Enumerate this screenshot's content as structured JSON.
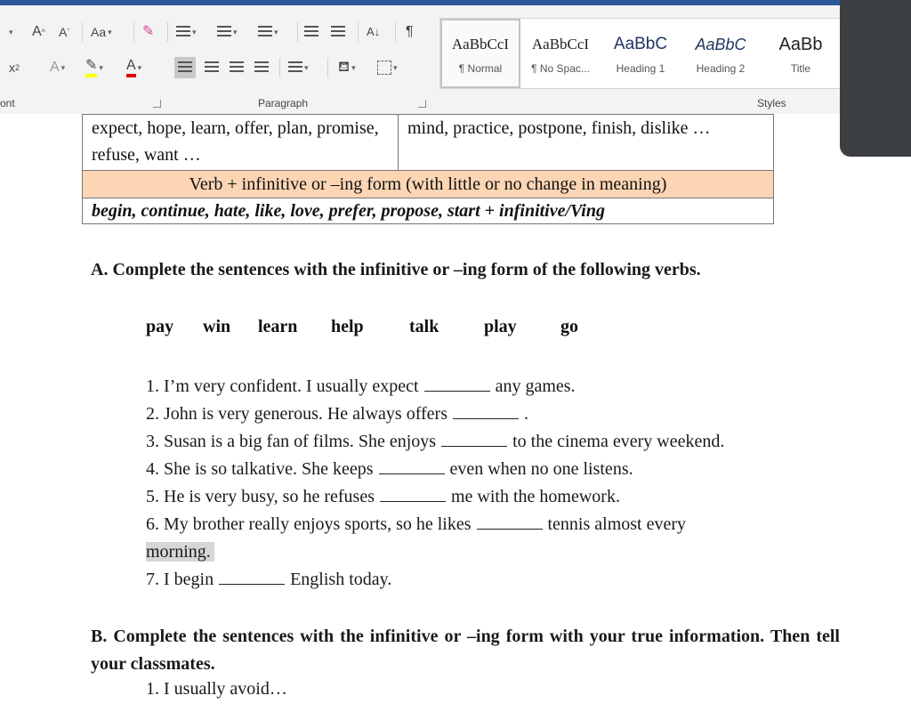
{
  "ribbon": {
    "font_group_label": "ont",
    "paragraph_group_label": "Paragraph",
    "styles_group_label": "Styles",
    "font_size_grow": "A",
    "font_size_shrink": "A",
    "change_case": "Aa",
    "subscript": "x",
    "text_effects": "A",
    "font_color": "A",
    "sort": "A↓",
    "pilcrow": "¶",
    "highlight_color": "#ffff00",
    "font_color_value": "#e00000",
    "styles": [
      {
        "sample": "AaBbCcI",
        "name": "¶ Normal"
      },
      {
        "sample": "AaBbCcI",
        "name": "¶ No Spac..."
      },
      {
        "sample": "AaBbC",
        "name": "Heading 1"
      },
      {
        "sample": "AaBbC",
        "name": "Heading 2"
      },
      {
        "sample": "AaBb",
        "name": "Title"
      }
    ]
  },
  "table": {
    "left_cell": "expect, hope, learn, offer, plan, promise, refuse, want …",
    "right_cell": "mind, practice, postpone, finish, dislike …",
    "band_header": "Verb + infinitive or –ing form (with little or no change in meaning)",
    "band_row": "begin, continue, hate, like, love, prefer, propose, start + infinitive/Ving",
    "band_color": "#fcd5b4"
  },
  "sectionA": {
    "heading": "A. Complete the sentences with the infinitive or –ing form of the following verbs.",
    "words": [
      "pay",
      "win",
      "learn",
      "help",
      "talk",
      "play",
      "go"
    ],
    "sentences": [
      {
        "before": "1. I’m very confident. I usually expect",
        "after": "any games."
      },
      {
        "before": "2. John is very generous. He always offers",
        "after": "."
      },
      {
        "before": "3. Susan is a big fan of films. She enjoys",
        "after": "to the cinema every weekend."
      },
      {
        "before": "4. She is so talkative. She keeps",
        "after": "even when no one listens."
      },
      {
        "before": "5. He is very busy, so he refuses",
        "after": "me with the homework."
      },
      {
        "before": "6. My brother really enjoys sports, so he likes",
        "after": "tennis almost every"
      },
      {
        "before": "7. I begin",
        "after": "English today."
      }
    ],
    "continuation": "morning."
  },
  "sectionB": {
    "heading": "B. Complete the sentences with the infinitive or –ing form with your true information. Then tell your classmates.",
    "item1": "1. I usually avoid…"
  }
}
